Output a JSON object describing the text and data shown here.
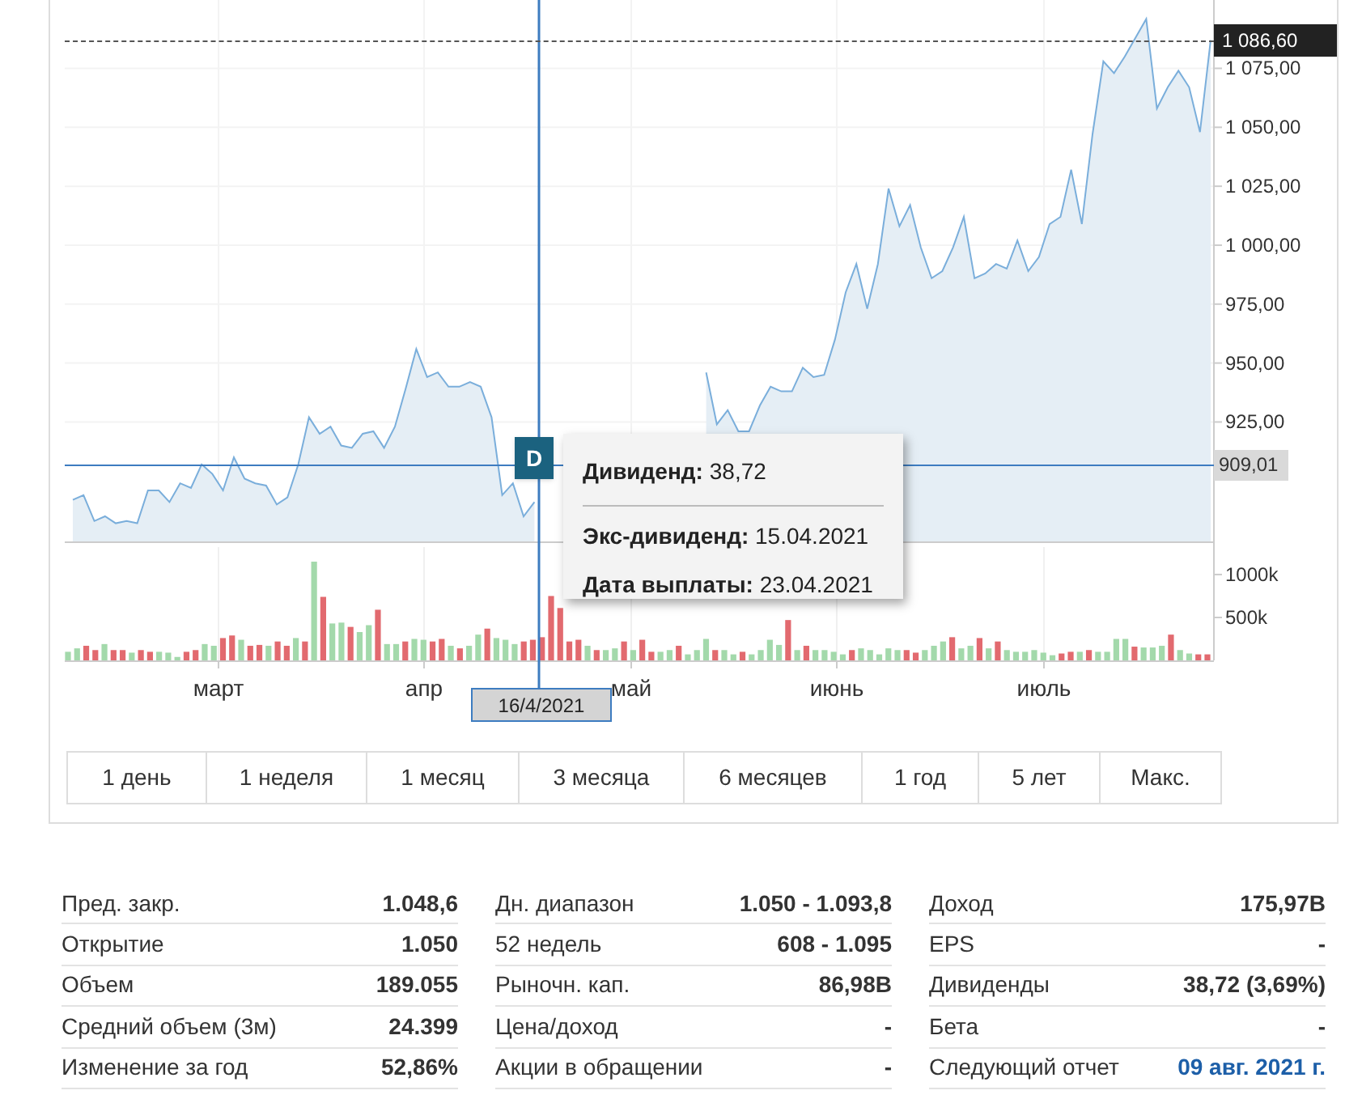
{
  "price_chart": {
    "chart_data": {
      "type": "area",
      "series": [
        {
          "color": "#7aaedb",
          "values": [
            892,
            894,
            883,
            885,
            882,
            883,
            882,
            896,
            896,
            891,
            899,
            897,
            907,
            903,
            896,
            910,
            901,
            899,
            898,
            890,
            893,
            907,
            927,
            920,
            923,
            915,
            914,
            920,
            921,
            914,
            923,
            939,
            956,
            944,
            946,
            940,
            940,
            942,
            940,
            927,
            894,
            899,
            885,
            891,
            null,
            null,
            null,
            null,
            null,
            null,
            null,
            null,
            null,
            null,
            null,
            null,
            null,
            null,
            null,
            946,
            924,
            930,
            921,
            921,
            932,
            940,
            938,
            938,
            948,
            944,
            945,
            960,
            980,
            992,
            973,
            992,
            1024,
            1008,
            1017,
            999,
            986,
            989,
            999,
            1012,
            986,
            988,
            992,
            990,
            1002,
            989,
            995,
            1009,
            1012,
            1032,
            1009,
            1047,
            1078,
            1073,
            1080,
            1088,
            1096,
            1058,
            1067,
            1074,
            1067,
            1048,
            1087
          ]
        }
      ],
      "ylim": [
        874,
        1104
      ],
      "grid": true,
      "yticks": [
        {
          "value": 925,
          "label": "925,00"
        },
        {
          "value": 950,
          "label": "950,00"
        },
        {
          "value": 975,
          "label": "975,00"
        },
        {
          "value": 1000,
          "label": "1 000,00"
        },
        {
          "value": 1025,
          "label": "1 025,00"
        },
        {
          "value": 1050,
          "label": "1 050,00"
        },
        {
          "value": 1075,
          "label": "1 075,00"
        }
      ]
    },
    "last_price": {
      "label": "1 086,60"
    },
    "crosshair": {
      "price": "909,01",
      "date": "16/4/2021"
    },
    "dividend_marker": {
      "label": "D"
    },
    "tooltip": {
      "rows": [
        {
          "label": "Дивиденд:",
          "value": "38,72"
        },
        {
          "label": "Экс-дивиденд:",
          "value": "15.04.2021"
        },
        {
          "label": "Дата выплаты:",
          "value": "23.04.2021"
        }
      ]
    }
  },
  "volume_chart": {
    "chart_data": {
      "type": "bar",
      "ylim": [
        0,
        1320
      ],
      "yticks": [
        {
          "value": 500,
          "label": "500k"
        },
        {
          "value": 1000,
          "label": "1000k"
        }
      ],
      "series": [
        {
          "color": "#a3d9ab",
          "values": [
            100,
            140,
            null,
            null,
            190,
            null,
            null,
            90,
            null,
            null,
            100,
            90,
            40,
            null,
            null,
            190,
            170,
            null,
            null,
            240,
            null,
            null,
            170,
            null,
            null,
            260,
            null,
            1150,
            null,
            430,
            440,
            null,
            330,
            410,
            null,
            190,
            190,
            null,
            250,
            240,
            null,
            null,
            170,
            null,
            170,
            300,
            null,
            260,
            240,
            190,
            null,
            null,
            null,
            null,
            null,
            null,
            null,
            170,
            null,
            120,
            140,
            null,
            120,
            null,
            null,
            100,
            120,
            null,
            70,
            120,
            250,
            null,
            120,
            70,
            null,
            70,
            120,
            240,
            180,
            null,
            120,
            null,
            120,
            120,
            100,
            70,
            null,
            140,
            120,
            70,
            140,
            120,
            null,
            null,
            120,
            170,
            220,
            null,
            140,
            170,
            null,
            140,
            null,
            120,
            100,
            100,
            120,
            90,
            60,
            null,
            null,
            100,
            null,
            100,
            100,
            250,
            250,
            null,
            150,
            150,
            170,
            null,
            120,
            80,
            null,
            null
          ]
        },
        {
          "color": "#e26a6f",
          "values": [
            null,
            null,
            170,
            120,
            null,
            120,
            120,
            null,
            120,
            100,
            null,
            null,
            null,
            100,
            120,
            null,
            null,
            260,
            290,
            null,
            170,
            180,
            null,
            220,
            170,
            null,
            220,
            null,
            740,
            null,
            null,
            390,
            null,
            null,
            590,
            null,
            null,
            220,
            null,
            null,
            220,
            250,
            null,
            140,
            null,
            null,
            370,
            null,
            null,
            null,
            220,
            240,
            270,
            750,
            610,
            220,
            240,
            null,
            120,
            null,
            null,
            220,
            null,
            240,
            100,
            null,
            null,
            170,
            null,
            null,
            null,
            120,
            null,
            null,
            100,
            null,
            null,
            null,
            null,
            470,
            null,
            170,
            null,
            null,
            null,
            null,
            120,
            null,
            null,
            null,
            null,
            null,
            120,
            90,
            null,
            null,
            null,
            270,
            null,
            null,
            260,
            null,
            220,
            null,
            null,
            null,
            null,
            null,
            null,
            80,
            100,
            null,
            120,
            null,
            null,
            null,
            null,
            160,
            null,
            null,
            null,
            300,
            null,
            null,
            70,
            70
          ]
        }
      ]
    }
  },
  "months": [
    "март",
    "апр",
    "май",
    "июнь",
    "июль"
  ],
  "ranges": [
    {
      "label": "1 день"
    },
    {
      "label": "1 неделя"
    },
    {
      "label": "1 месяц"
    },
    {
      "label": "3 месяца"
    },
    {
      "label": "6 месяцев"
    },
    {
      "label": "1 год"
    },
    {
      "label": "5 лет"
    },
    {
      "label": "Макс."
    }
  ],
  "stats": [
    [
      {
        "label": "Пред. закр.",
        "value": "1.048,6"
      },
      {
        "label": "Открытие",
        "value": "1.050"
      },
      {
        "label": "Объем",
        "value": "189.055"
      },
      {
        "label": "Средний объем (3м)",
        "value": "24.399"
      },
      {
        "label": "Изменение за год",
        "value": "52,86%"
      }
    ],
    [
      {
        "label": "Дн. диапазон",
        "value": "1.050 - 1.093,8"
      },
      {
        "label": "52 недель",
        "value": "608 - 1.095"
      },
      {
        "label": "Рыночн. кап.",
        "value": "86,98B"
      },
      {
        "label": "Цена/доход",
        "value": "-"
      },
      {
        "label": "Акции в обращении",
        "value": "-"
      }
    ],
    [
      {
        "label": "Доход",
        "value": "175,97B"
      },
      {
        "label": "EPS",
        "value": "-"
      },
      {
        "label": "Дивиденды",
        "value": "38,72 (3,69%)"
      },
      {
        "label": "Бета",
        "value": "-"
      },
      {
        "label": "Следующий отчет",
        "value": "09 авг. 2021 г.",
        "kind": "link"
      }
    ]
  ]
}
